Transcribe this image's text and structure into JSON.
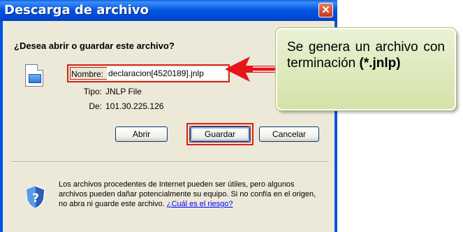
{
  "dialog": {
    "title": "Descarga de archivo",
    "question": "¿Desea abrir o guardar este archivo?",
    "fields": {
      "name_label": "Nombre:",
      "name_value": "declaracion[4520189].jnlp",
      "type_label": "Tipo:",
      "type_value": "JNLP File",
      "from_label": "De:",
      "from_value": "101.30.225.126"
    },
    "buttons": {
      "open": "Abrir",
      "save": "Guardar",
      "cancel": "Cancelar"
    },
    "warning_text": "Los archivos procedentes de Internet pueden ser útiles, pero algunos archivos pueden dañar potencialmente su equipo. Si no confía en el origen, no abra ni guarde este archivo.",
    "warning_link": "¿Cuál es el riesgo?",
    "icons": [
      "file-icon",
      "close-icon",
      "shield-icon"
    ]
  },
  "callout": {
    "text": "Se genera un archivo con terminación",
    "highlight": "(*.jnlp)"
  },
  "colors": {
    "titlebar": "#0055e5",
    "highlight_box": "#d1221c",
    "arrow": "#e5151c",
    "callout_bg": "#d4e2a8"
  }
}
